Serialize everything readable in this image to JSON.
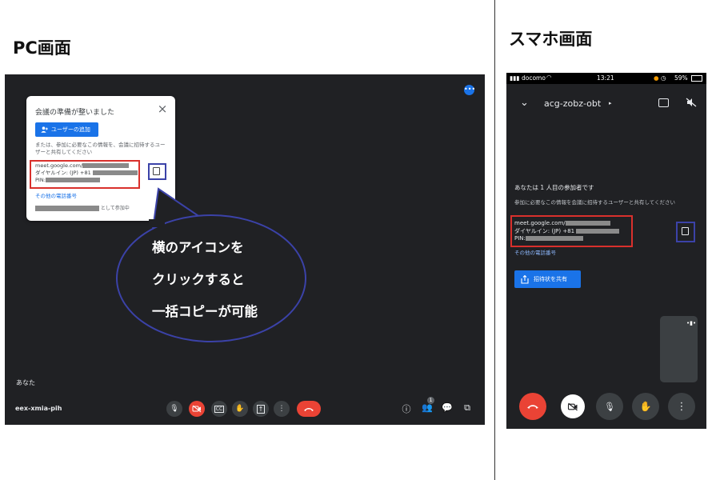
{
  "pc": {
    "heading": "PC画面",
    "card": {
      "title": "会議の準備が整いました",
      "close_icon": "×",
      "add_user_label": "ユーザーの追加",
      "description": "または、参加に必要なこの情報を、会議に招待するユーザーと共有してください",
      "meeting_url": "meet.google.com/",
      "dial_in": "ダイヤルイン: (JP) +81",
      "pin": "PIN:",
      "other_numbers": "その他の電話番号",
      "joined_suffix": "として参加中"
    },
    "you_label": "あなた",
    "meeting_code": "eex-xmia-pih",
    "participant_count": "1",
    "callout": [
      "横のアイコンを",
      "クリックすると",
      "一括コピーが可能"
    ]
  },
  "phone": {
    "heading": "スマホ画面",
    "status": {
      "carrier": "docomo",
      "time": "13:21",
      "battery": "59%"
    },
    "meeting_code": "acg-zobz-obt",
    "participant_text": "あなたは 1 人目の参加者です",
    "share_prompt": "参加に必要なこの情報を会議に招待するユーザーと共有してください",
    "meeting_url": "meet.google.com/",
    "dial_in": "ダイヤルイン: (JP) +81",
    "pin": "PIN:",
    "other_numbers": "その他の電話番号",
    "share_button": "招待状を共有"
  },
  "colors": {
    "meet_bg": "#202124",
    "accent_blue": "#1a73e8",
    "end_red": "#ea4335",
    "highlight_red": "#d9302c",
    "highlight_blue": "#3b42a8"
  }
}
